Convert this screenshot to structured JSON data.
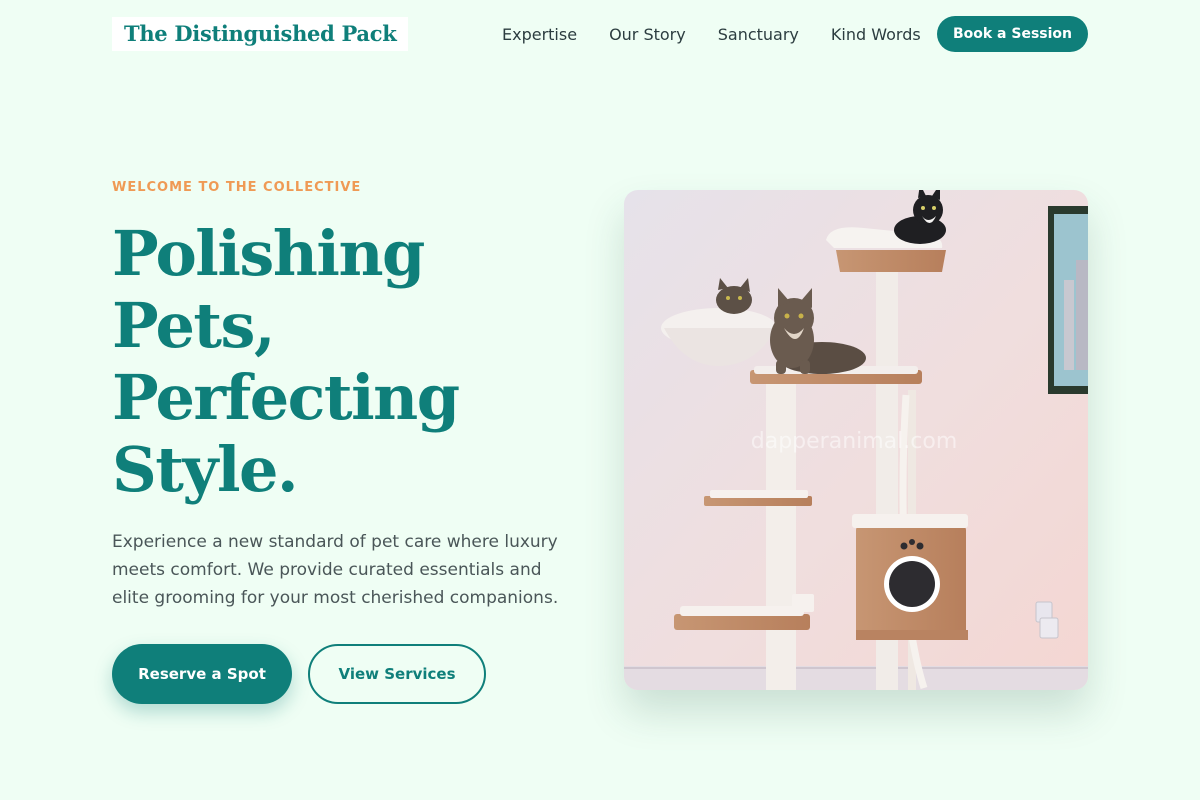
{
  "header": {
    "logo": "The Distinguished Pack",
    "nav": [
      "Expertise",
      "Our Story",
      "Sanctuary",
      "Kind Words"
    ],
    "cta": "Book a Session"
  },
  "hero": {
    "eyebrow": "WELCOME TO THE COLLECTIVE",
    "headline_lines": [
      "Polishing",
      "Pets,",
      "Perfecting",
      "Style."
    ],
    "description": "Experience a new standard of pet care where luxury meets comfort. We provide curated essentials and elite grooming for your most cherished companions.",
    "primary_button": "Reserve a Spot",
    "secondary_button": "View Services",
    "image_watermark": "dapperanimal.com"
  },
  "colors": {
    "background": "#effef4",
    "brand": "#0f7f7a",
    "accent": "#ef9a55"
  }
}
